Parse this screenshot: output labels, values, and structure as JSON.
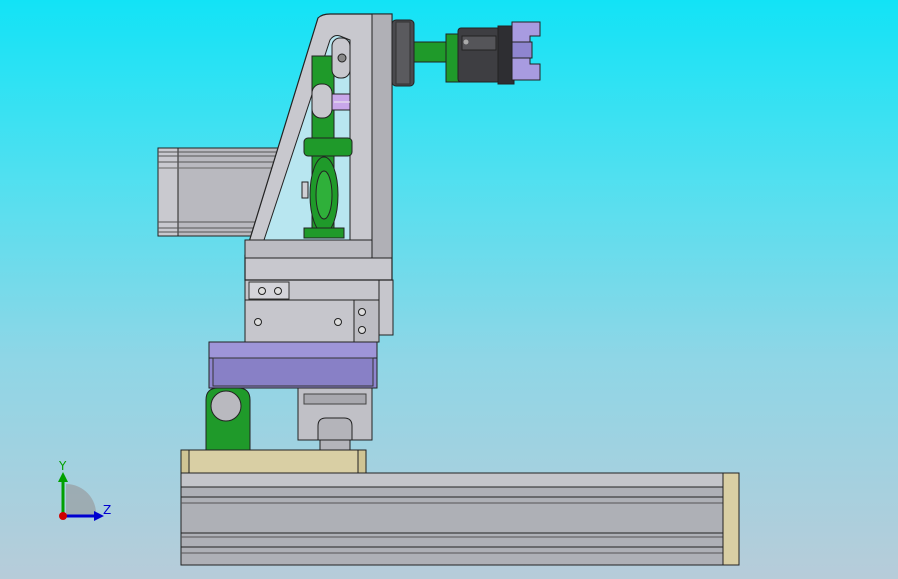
{
  "viewport": {
    "background_top": "#12e3f6",
    "background_bottom": "#b7ccd9"
  },
  "triad": {
    "y_label": "Y",
    "z_label": "Z",
    "y_color": "#00a000",
    "z_color": "#0000d0",
    "x_color": "#d00000"
  },
  "colors": {
    "steel": "#b4b4ba",
    "steel_dark": "#8e8e96",
    "green": "#1f9a2a",
    "purple": "#8f85cf",
    "violet": "#c9a7ea",
    "tan": "#d9cfa4",
    "outline": "#222222"
  }
}
